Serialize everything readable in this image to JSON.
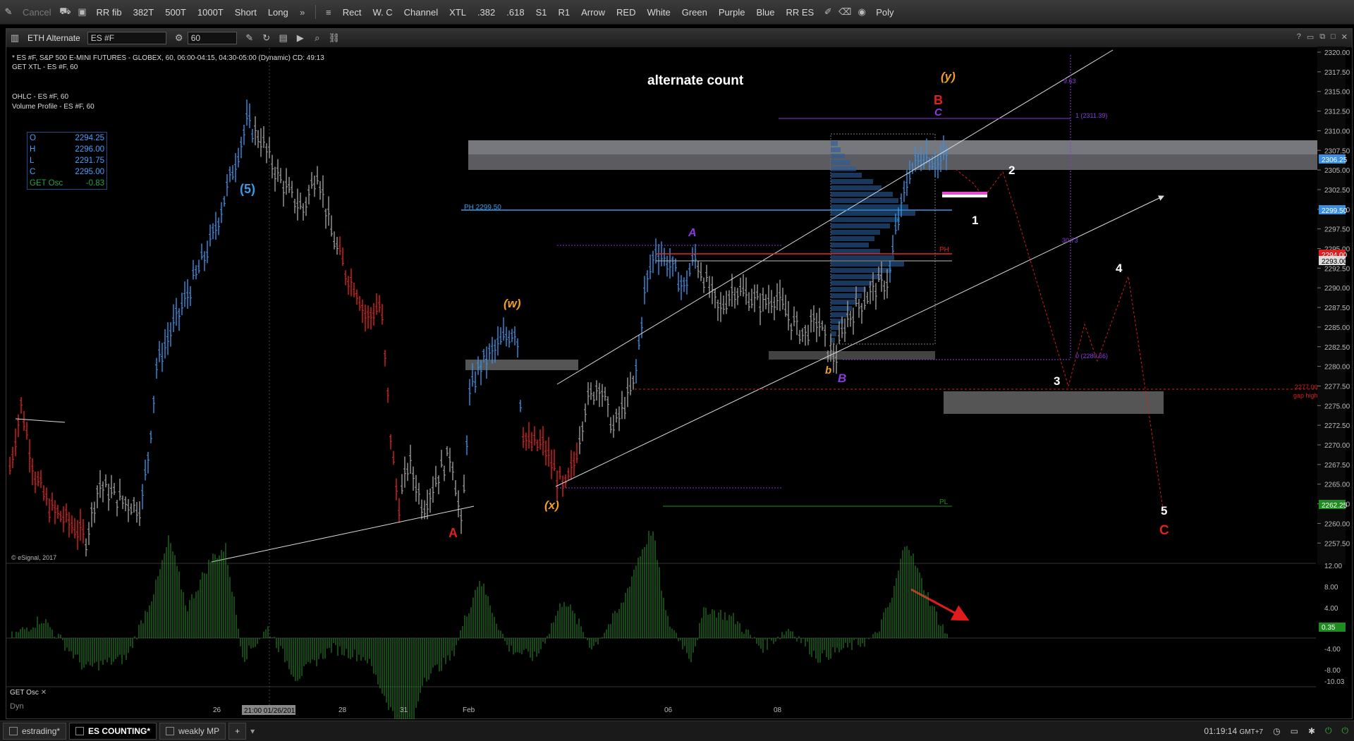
{
  "toolbar": {
    "items": [
      "Cancel",
      "RR fib",
      "382T",
      "500T",
      "1000T",
      "Short",
      "Long",
      "Rect",
      "W. C",
      "Channel",
      "XTL",
      ".382",
      ".618",
      "S1",
      "R1",
      "Arrow",
      "RED",
      "White",
      "Green",
      "Purple",
      "Blue",
      "RR ES",
      "Poly"
    ]
  },
  "window": {
    "title": "ETH Alternate",
    "symbol": "ES #F",
    "interval": "60"
  },
  "info": {
    "line1": "* ES #F, S&P 500 E-MINI FUTURES - GLOBEX, 60, 06:00-04:15, 04:30-05:00 (Dynamic) CD: 49:13",
    "line2": "GET XTL - ES #F, 60",
    "line3": "OHLC - ES #F, 60",
    "line4": "Volume Profile - ES #F, 60",
    "copyright": "© eSignal, 2017"
  },
  "ohlc": {
    "O": "2294.25",
    "H": "2296.00",
    "L": "2291.75",
    "C": "2295.00",
    "osc_label": "GET Osc",
    "osc": "-0.83"
  },
  "annotations": {
    "title": "alternate count",
    "wave5": "(5)",
    "waveA_red": "A",
    "waveW": "(w)",
    "waveX": "(x)",
    "waveY": "(y)",
    "waveA_purple": "A",
    "waveB_red": "B",
    "waveC_purple": "C",
    "wave_b_small": "b",
    "waveB_purple": "B",
    "n1": "1",
    "n2": "2",
    "n3": "3",
    "n4": "4",
    "n5": "5",
    "waveC_red": "C",
    "ph_label": "PH 2299.50",
    "ph_small": "PH",
    "pl_small": "PL",
    "fib_1": "1 (2311.39)",
    "fib_0": "0 (2280.66)",
    "fib_top": "9.63",
    "fib_mid": "30.73",
    "gap_price": "2277.00",
    "gap_text": "gap high"
  },
  "price_axis": {
    "ticks": [
      "2320.00",
      "2317.50",
      "2315.00",
      "2312.50",
      "2310.00",
      "2307.50",
      "2305.00",
      "2302.50",
      "2300.00",
      "2297.50",
      "2295.00",
      "2292.50",
      "2290.00",
      "2287.50",
      "2285.00",
      "2282.50",
      "2280.00",
      "2277.50",
      "2275.00",
      "2272.50",
      "2270.00",
      "2267.50",
      "2265.00",
      "2262.50",
      "2260.00",
      "2257.50"
    ],
    "current": "2306.25",
    "ph_tag": "2299.50",
    "red_tag": "2294.00",
    "white_tag": "2293.00",
    "pl_tag": "2262.25"
  },
  "osc_axis": {
    "ticks": [
      "12.00",
      "8.00",
      "4.00",
      "0.00",
      "-4.00",
      "-8.00",
      "-10.03"
    ],
    "current": "0.35"
  },
  "time_axis": {
    "labels": [
      "26",
      "28",
      "31",
      "Feb",
      "06",
      "08"
    ],
    "highlight": "21:00 01/26/2017"
  },
  "osc_panel": {
    "label": "GET Osc",
    "dyn": "Dyn"
  },
  "bottom_tabs": [
    "estrading*",
    "ES COUNTING*",
    "weakly MP"
  ],
  "status": {
    "time": "01:19:14",
    "tz": "GMT+7"
  },
  "colors": {
    "up": "#3a8fe0",
    "down": "#e02020",
    "neutral": "#9a9a9a",
    "orange": "#f0a020",
    "purple": "#8a3ae0",
    "osc": "#2fae2f"
  }
}
